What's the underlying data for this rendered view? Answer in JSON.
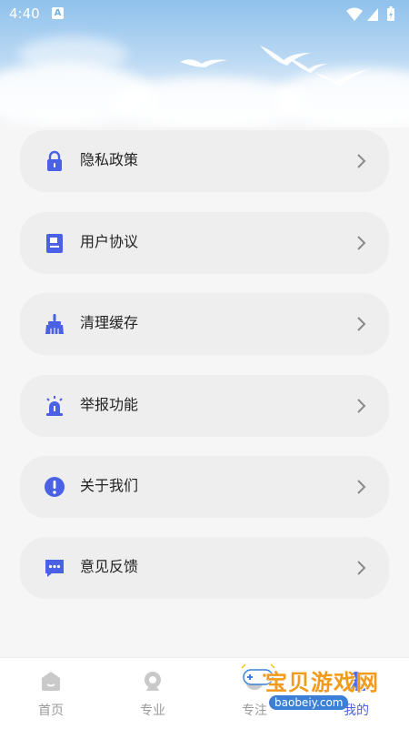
{
  "status_bar": {
    "time": "4:40",
    "notification_badge": "A",
    "icons": [
      "wifi-icon",
      "signal-icon",
      "battery-icon"
    ]
  },
  "menu": {
    "items": [
      {
        "label": "隐私政策",
        "icon": "lock-icon"
      },
      {
        "label": "用户协议",
        "icon": "document-icon"
      },
      {
        "label": "清理缓存",
        "icon": "broom-icon"
      },
      {
        "label": "举报功能",
        "icon": "alarm-icon"
      },
      {
        "label": "关于我们",
        "icon": "info-icon"
      },
      {
        "label": "意见反馈",
        "icon": "feedback-icon"
      }
    ]
  },
  "tab_bar": {
    "tabs": [
      {
        "label": "首页",
        "icon": "home-icon"
      },
      {
        "label": "专业",
        "icon": "major-icon"
      },
      {
        "label": "专注",
        "icon": "focus-icon"
      },
      {
        "label": "我的",
        "icon": "profile-icon",
        "active": true
      }
    ]
  },
  "watermark": {
    "title": "宝贝游戏网",
    "url": "baobeiy.com"
  },
  "colors": {
    "accent": "#4a61e6",
    "row_bg": "#eeeeee",
    "page_bg": "#f6f6f6"
  }
}
